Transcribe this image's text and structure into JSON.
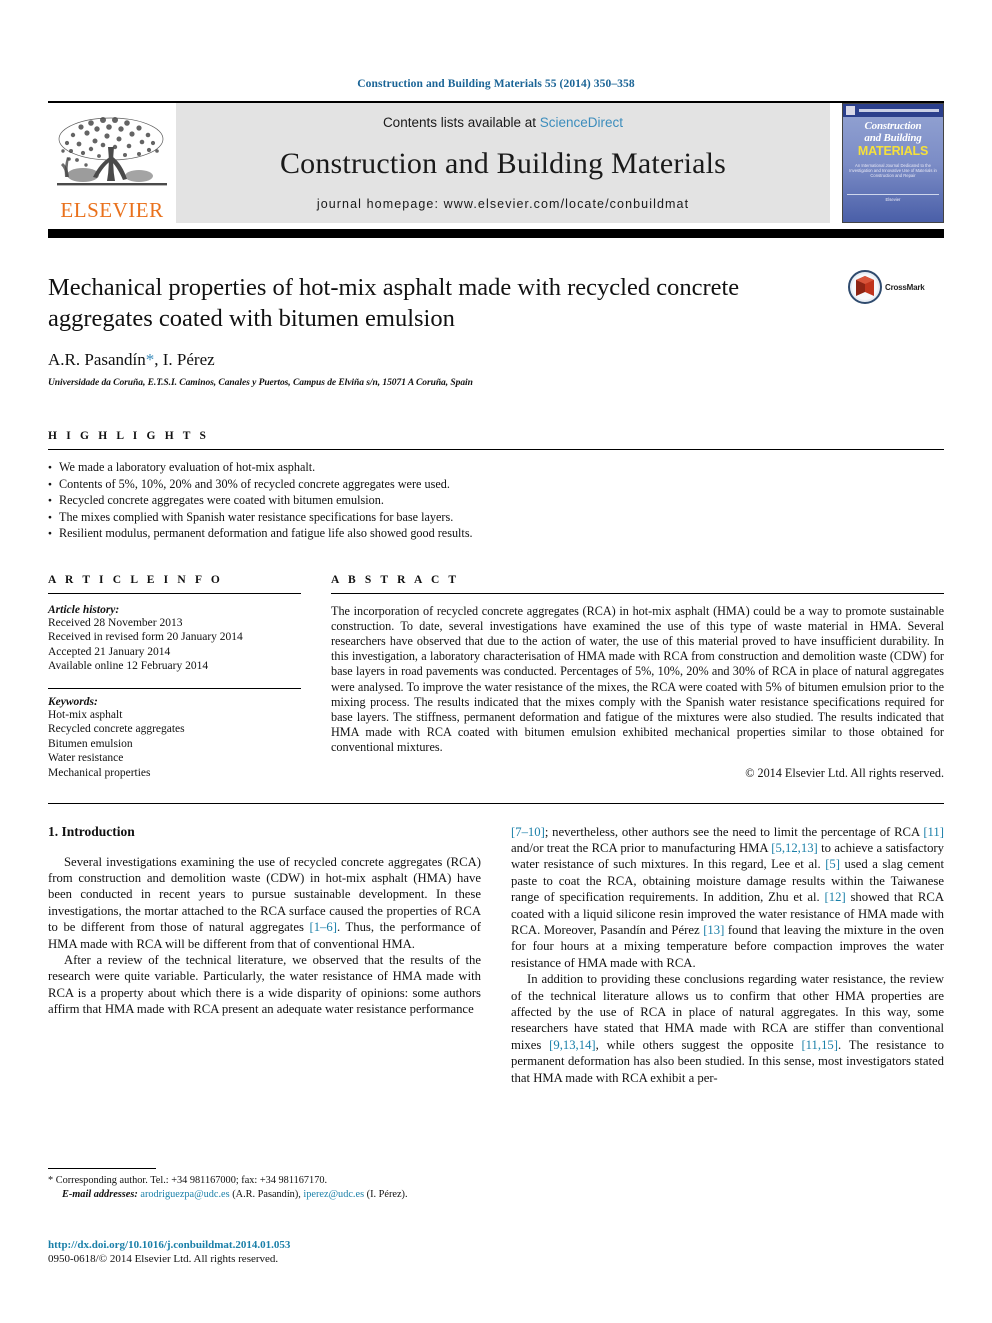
{
  "running_head": "Construction and Building Materials 55 (2014) 350–358",
  "masthead": {
    "publisher_logo_label": "ELSEVIER",
    "contents_prefix": "Contents lists available at ",
    "contents_link": "ScienceDirect",
    "journal_name": "Construction and Building Materials",
    "homepage": "journal homepage: www.elsevier.com/locate/conbuildmat",
    "cover": {
      "line1": "Construction",
      "line2": "and Building",
      "line3": "MATERIALS",
      "blurb": "An International Journal Dedicated to the Investigation and Innovative Use of Materials in Construction and Repair",
      "footer": "Elsevier"
    }
  },
  "article": {
    "title": "Mechanical properties of hot-mix asphalt made with recycled concrete aggregates coated with bitumen emulsion",
    "authors_pre": "A.R. Pasandín",
    "authors_star": "*",
    "authors_post": ", I. Pérez",
    "affiliation": "Universidade da Coruña, E.T.S.I. Caminos, Canales y Puertos, Campus de Elviña s/n, 15071 A Coruña, Spain",
    "crossmark_label": "CrossMark"
  },
  "highlights": {
    "heading": "H I G H L I G H T S",
    "items": [
      "We made a laboratory evaluation of hot-mix asphalt.",
      "Contents of 5%, 10%, 20% and 30% of recycled concrete aggregates were used.",
      "Recycled concrete aggregates were coated with bitumen emulsion.",
      "The mixes complied with Spanish water resistance specifications for base layers.",
      "Resilient modulus, permanent deformation and fatigue life also showed good results."
    ]
  },
  "article_info": {
    "heading": "A R T I C L E    I N F O",
    "history_label": "Article history:",
    "history": [
      "Received 28 November 2013",
      "Received in revised form 20 January 2014",
      "Accepted 21 January 2014",
      "Available online 12 February 2014"
    ],
    "keywords_label": "Keywords:",
    "keywords": [
      "Hot-mix asphalt",
      "Recycled concrete aggregates",
      "Bitumen emulsion",
      "Water resistance",
      "Mechanical properties"
    ]
  },
  "abstract": {
    "heading": "A B S T R A C T",
    "text": "The incorporation of recycled concrete aggregates (RCA) in hot-mix asphalt (HMA) could be a way to promote sustainable construction. To date, several investigations have examined the use of this type of waste material in HMA. Several researchers have observed that due to the action of water, the use of this material proved to have insufficient durability. In this investigation, a laboratory characterisation of HMA made with RCA from construction and demolition waste (CDW) for base layers in road pavements was conducted. Percentages of 5%, 10%, 20% and 30% of RCA in place of natural aggregates were analysed. To improve the water resistance of the mixes, the RCA were coated with 5% of bitumen emulsion prior to the mixing process. The results indicated that the mixes comply with the Spanish water resistance specifications required for base layers. The stiffness, permanent deformation and fatigue of the mixtures were also studied. The results indicated that HMA made with RCA coated with bitumen emulsion exhibited mechanical properties similar to those obtained for conventional mixtures.",
    "copyright": "© 2014 Elsevier Ltd. All rights reserved."
  },
  "body": {
    "section_heading": "1. Introduction",
    "left": [
      "Several investigations examining the use of recycled concrete aggregates (RCA) from construction and demolition waste (CDW) in hot-mix asphalt (HMA) have been conducted in recent years to pursue sustainable development. In these investigations, the mortar attached to the RCA surface caused the properties of RCA to be different from those of natural aggregates [1–6]. Thus, the performance of HMA made with RCA will be different from that of conventional HMA.",
      "After a review of the technical literature, we observed that the results of the research were quite variable. Particularly, the water resistance of HMA made with RCA is a property about which there is a wide disparity of opinions: some authors affirm that HMA made with RCA present an adequate water resistance performance"
    ],
    "right": [
      "[7–10]; nevertheless, other authors see the need to limit the percentage of RCA [11] and/or treat the RCA prior to manufacturing HMA [5,12,13] to achieve a satisfactory water resistance of such mixtures. In this regard, Lee et al. [5] used a slag cement paste to coat the RCA, obtaining moisture damage results within the Taiwanese range of specification requirements. In addition, Zhu et al. [12] showed that RCA coated with a liquid silicone resin improved the water resistance of HMA made with RCA. Moreover, Pasandín and Pérez [13] found that leaving the mixture in the oven for four hours at a mixing temperature before compaction improves the water resistance of HMA made with RCA.",
      "In addition to providing these conclusions regarding water resistance, the review of the technical literature allows us to confirm that other HMA properties are affected by the use of RCA in place of natural aggregates. In this way, some researchers have stated that HMA made with RCA are stiffer than conventional mixes [9,13,14], while others suggest the opposite [11,15]. The resistance to permanent deformation has also been studied. In this sense, most investigators stated that HMA made with RCA exhibit a per-"
    ]
  },
  "footnote": {
    "corresponding": "* Corresponding author. Tel.: +34 981167000; fax: +34 981167170.",
    "email_label": "E-mail addresses:",
    "email1": "arodriguezpa@udc.es",
    "email1_name": " (A.R. Pasandín), ",
    "email2": "iperez@udc.es",
    "email2_name": " (I. Pérez)."
  },
  "doi": {
    "url": "http://dx.doi.org/10.1016/j.conbuildmat.2014.01.053",
    "issn": "0950-0618/© 2014 Elsevier Ltd. All rights reserved."
  },
  "colors": {
    "link": "#1a7fa8",
    "sciencedirect": "#3c8dbc",
    "elsevier_orange": "#E9711C",
    "masthead_bg": "#e3e3e3",
    "cover_blue": "#4a5fa8",
    "crossmark_red": "#c0341d"
  }
}
